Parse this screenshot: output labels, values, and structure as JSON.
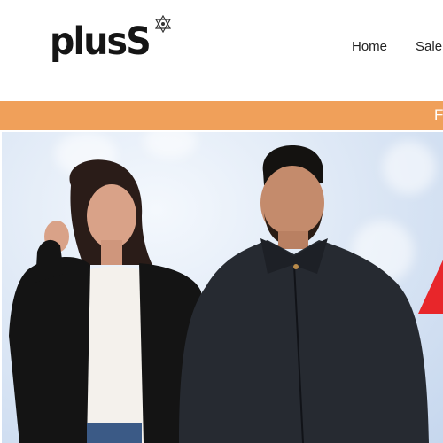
{
  "brand": {
    "name": "plusS",
    "star_icon": "star-of-david-icon"
  },
  "nav": {
    "items": [
      {
        "label": "Home"
      },
      {
        "label": "Sale"
      }
    ]
  },
  "announcement": {
    "text": "F",
    "background": "#f0a05a"
  },
  "hero": {
    "image": "woman-and-man-models",
    "accent": "#e8262a"
  }
}
